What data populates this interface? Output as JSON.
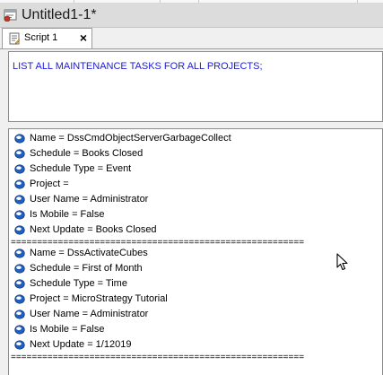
{
  "window": {
    "title": "Untitled1-1*",
    "app_icon": "script-window-icon"
  },
  "tabs": [
    {
      "label": "Script 1",
      "close_label": "×"
    }
  ],
  "editor": {
    "text": "LIST ALL MAINTENANCE TASKS FOR ALL PROJECTS;"
  },
  "results": {
    "groups": [
      {
        "rows": [
          "Name = DssCmdObjectServerGarbageCollect",
          "Schedule = Books Closed",
          "Schedule Type = Event",
          "Project =",
          "User Name = Administrator",
          "Is Mobile = False",
          "Next Update = Books Closed"
        ],
        "divider": "========================================================"
      },
      {
        "rows": [
          "Name = DssActivateCubes",
          "Schedule = First of Month",
          "Schedule Type = Time",
          "Project = MicroStrategy Tutorial",
          "User Name = Administrator",
          "Is Mobile = False",
          "Next Update = 1/12019"
        ],
        "divider": "========================================================"
      }
    ]
  },
  "colors": {
    "query_text": "#1b1bd6",
    "bullet": "#1f5fbf"
  }
}
